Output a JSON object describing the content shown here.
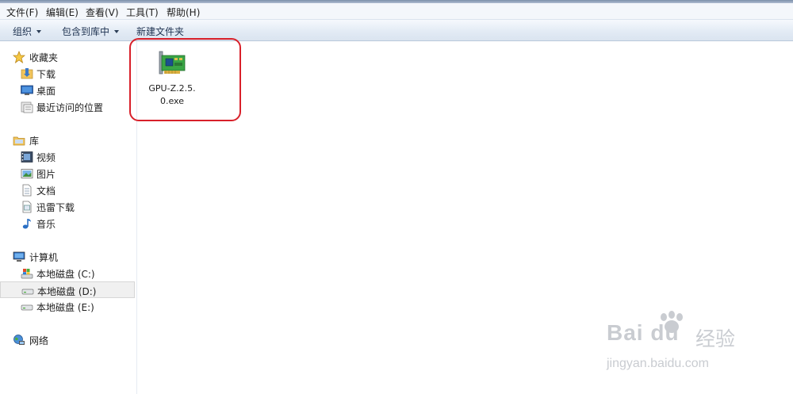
{
  "menubar": {
    "items": [
      "文件(F)",
      "编辑(E)",
      "查看(V)",
      "工具(T)",
      "帮助(H)"
    ]
  },
  "toolbar": {
    "organize": "组织",
    "include_library": "包含到库中",
    "new_folder": "新建文件夹"
  },
  "sidebar": {
    "favorites": {
      "header": "收藏夹",
      "items": [
        "下载",
        "桌面",
        "最近访问的位置"
      ]
    },
    "libraries": {
      "header": "库",
      "items": [
        "视频",
        "图片",
        "文档",
        "迅雷下载",
        "音乐"
      ]
    },
    "computer": {
      "header": "计算机",
      "items": [
        "本地磁盘 (C:)",
        "本地磁盘 (D:)",
        "本地磁盘 (E:)"
      ],
      "selected": "本地磁盘 (D:)"
    },
    "network": {
      "header": "网络"
    }
  },
  "files": [
    {
      "name_line1": "GPU-Z.2.5.",
      "name_line2": "0.exe",
      "icon": "gpu-card-icon"
    }
  ],
  "annotation": {
    "color": "#d8202a"
  },
  "watermark": {
    "brand": "Bai du",
    "cn": "经验",
    "url": "jingyan.baidu.com"
  }
}
